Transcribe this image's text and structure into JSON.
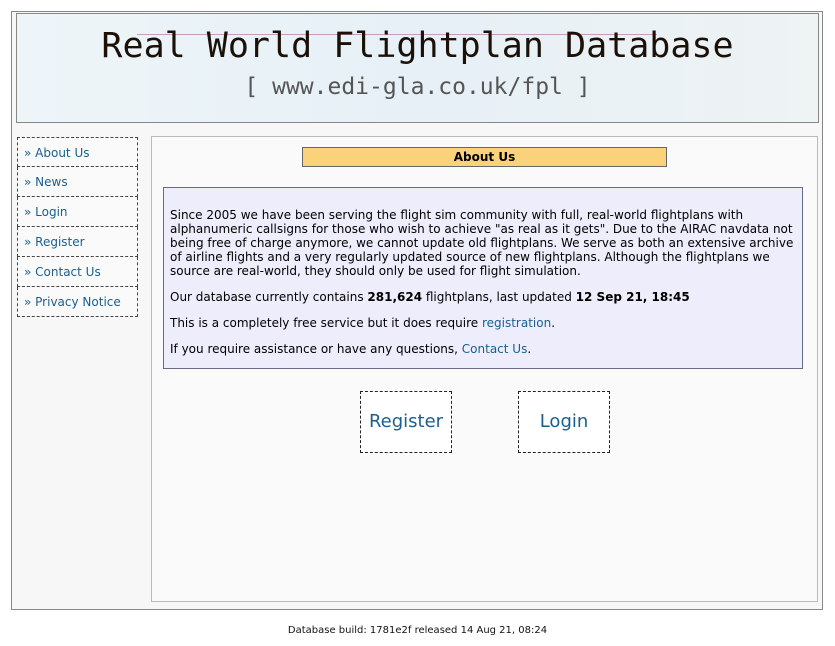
{
  "header": {
    "title": "Real World Flightplan Database",
    "subtitle": "[ www.edi-gla.co.uk/fpl ]"
  },
  "sidebar": {
    "items": [
      {
        "label": "About Us"
      },
      {
        "label": "News"
      },
      {
        "label": "Login"
      },
      {
        "label": "Register"
      },
      {
        "label": "Contact Us"
      },
      {
        "label": "Privacy Notice"
      }
    ]
  },
  "main": {
    "section_title": "About Us",
    "intro": "Since 2005 we have been serving the flight sim community with full, real-world flightplans with alphanumeric callsigns for those who wish to achieve \"as real as it gets\". Due to the AIRAC navdata not being free of charge anymore, we cannot update old flightplans. We serve as both an extensive archive of airline flights and a very regularly updated source of new flightplans. Although the flightplans we source are real-world, they should only be used for flight simulation.",
    "stats_prefix": "Our database currently contains ",
    "count": "281,624",
    "stats_mid": " flightplans, last updated ",
    "updated": "12 Sep 21, 18:45",
    "free_text": "This is a completely free service but it does require ",
    "registration_link": "registration",
    "free_end": ".",
    "help_text": "If you require assistance or have any questions, ",
    "contact_link": "Contact Us",
    "help_end": ".",
    "register_button": "Register",
    "login_button": "Login"
  },
  "footer": "Database build: 1781e2f released 14 Aug 21, 08:24"
}
